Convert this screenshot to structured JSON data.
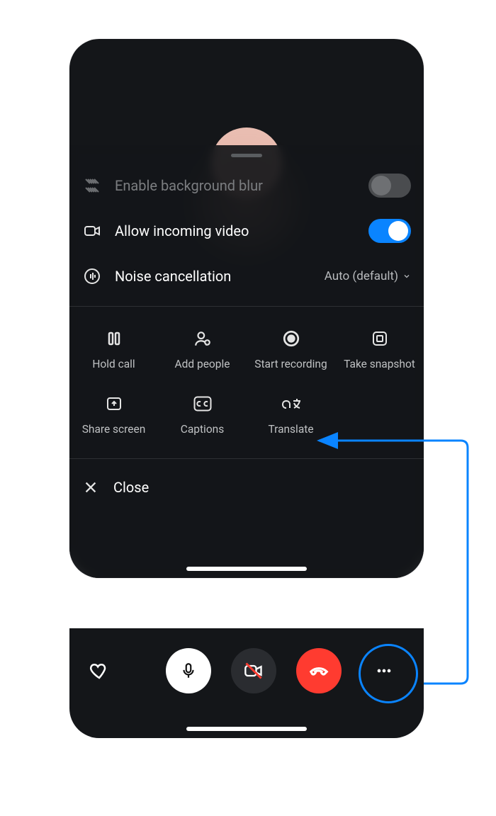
{
  "settings": {
    "blur": {
      "label": "Enable background blur",
      "on": false,
      "disabled": true
    },
    "video": {
      "label": "Allow incoming video",
      "on": true
    },
    "noise": {
      "label": "Noise cancellation",
      "value": "Auto (default)"
    }
  },
  "actions": {
    "hold": {
      "label": "Hold call"
    },
    "add": {
      "label": "Add people"
    },
    "record": {
      "label": "Start recording"
    },
    "snapshot": {
      "label": "Take snapshot"
    },
    "share": {
      "label": "Share screen"
    },
    "captions": {
      "label": "Captions"
    },
    "translate": {
      "label": "Translate"
    }
  },
  "close": {
    "label": "Close"
  },
  "annotation": {
    "highlight": "more-button",
    "points_to": "translate-action"
  }
}
